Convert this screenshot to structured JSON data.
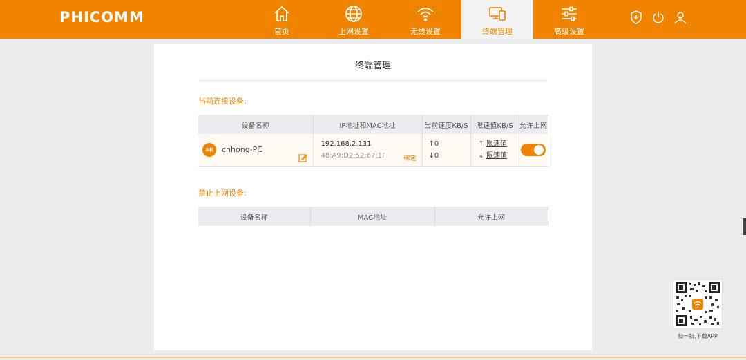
{
  "header": {
    "logo": "PHICOMM",
    "nav": [
      {
        "label": "首页",
        "icon": "home-icon"
      },
      {
        "label": "上网设置",
        "icon": "globe-icon"
      },
      {
        "label": "无线设置",
        "icon": "wifi-icon"
      },
      {
        "label": "终端管理",
        "icon": "devices-icon",
        "active": true
      },
      {
        "label": "高级设置",
        "icon": "sliders-icon"
      }
    ],
    "right_icons": [
      "shield-icon",
      "power-icon",
      "user-icon"
    ]
  },
  "page": {
    "title": "终端管理",
    "connected_section": "当前连接设备:",
    "connected_columns": [
      "设备名称",
      "IP地址和MAC地址",
      "当前速度KB/S",
      "限速值KB/S",
      "允许上网"
    ],
    "connected_devices": [
      {
        "badge": "本机",
        "name": "cnhong-PC",
        "ip": "192.168.2.131",
        "mac": "48:A9:D2:52:67:1F",
        "bind_label": "绑定",
        "up_speed": "↑0",
        "down_speed": "↓0",
        "up_limit": "限速值",
        "down_limit": "限速值",
        "allow_internet": true
      }
    ],
    "blocked_section": "禁止上网设备:",
    "blocked_columns": [
      "设备名称",
      "MAC地址",
      "允许上网"
    ]
  },
  "app_promo": {
    "caption": "扫一扫,下载APP"
  },
  "colors": {
    "brand": "#f08300",
    "background": "#ececec"
  }
}
